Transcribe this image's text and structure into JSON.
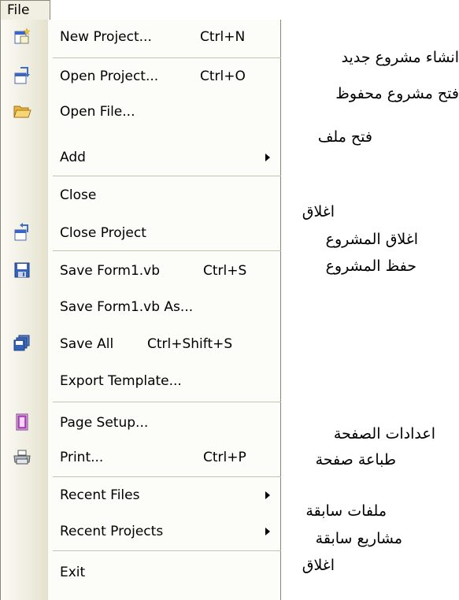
{
  "menubar": {
    "file_label": "File"
  },
  "menu": {
    "items": [
      {
        "label": "New Project...",
        "shortcut": "Ctrl+N",
        "icon": "new-project-icon"
      },
      {
        "label": "Open Project...",
        "shortcut": "Ctrl+O",
        "icon": "open-project-icon"
      },
      {
        "label": "Open File...",
        "shortcut": "",
        "icon": "open-folder-icon"
      },
      {
        "label": "Add",
        "shortcut": "",
        "icon": "",
        "submenu": true
      },
      {
        "label": "Close",
        "shortcut": "",
        "icon": ""
      },
      {
        "label": "Close Project",
        "shortcut": "",
        "icon": "close-project-icon"
      },
      {
        "label": "Save Form1.vb",
        "shortcut": "Ctrl+S",
        "icon": "save-disk-icon"
      },
      {
        "label": "Save Form1.vb As...",
        "shortcut": "",
        "icon": ""
      },
      {
        "label": "Save All",
        "shortcut": "Ctrl+Shift+S",
        "icon": "save-all-icon"
      },
      {
        "label": "Export Template...",
        "shortcut": "",
        "icon": ""
      },
      {
        "label": "Page Setup...",
        "shortcut": "",
        "icon": "page-setup-icon"
      },
      {
        "label": "Print...",
        "shortcut": "Ctrl+P",
        "icon": "printer-icon"
      },
      {
        "label": "Recent Files",
        "shortcut": "",
        "icon": "",
        "submenu": true
      },
      {
        "label": "Recent Projects",
        "shortcut": "",
        "icon": "",
        "submenu": true
      },
      {
        "label": "Exit",
        "shortcut": "",
        "icon": ""
      }
    ]
  },
  "annotations": [
    "انشاء مشروع جديد",
    "فتح مشروع محفوظ",
    "فتح ملف",
    "اغلاق",
    "اغلاق المشروع",
    "حفظ المشروع",
    "اعدادات الصفحة",
    "طباعة صفحة",
    "ملفات سابقة",
    "مشاريع سابقة",
    "اغلاق"
  ]
}
